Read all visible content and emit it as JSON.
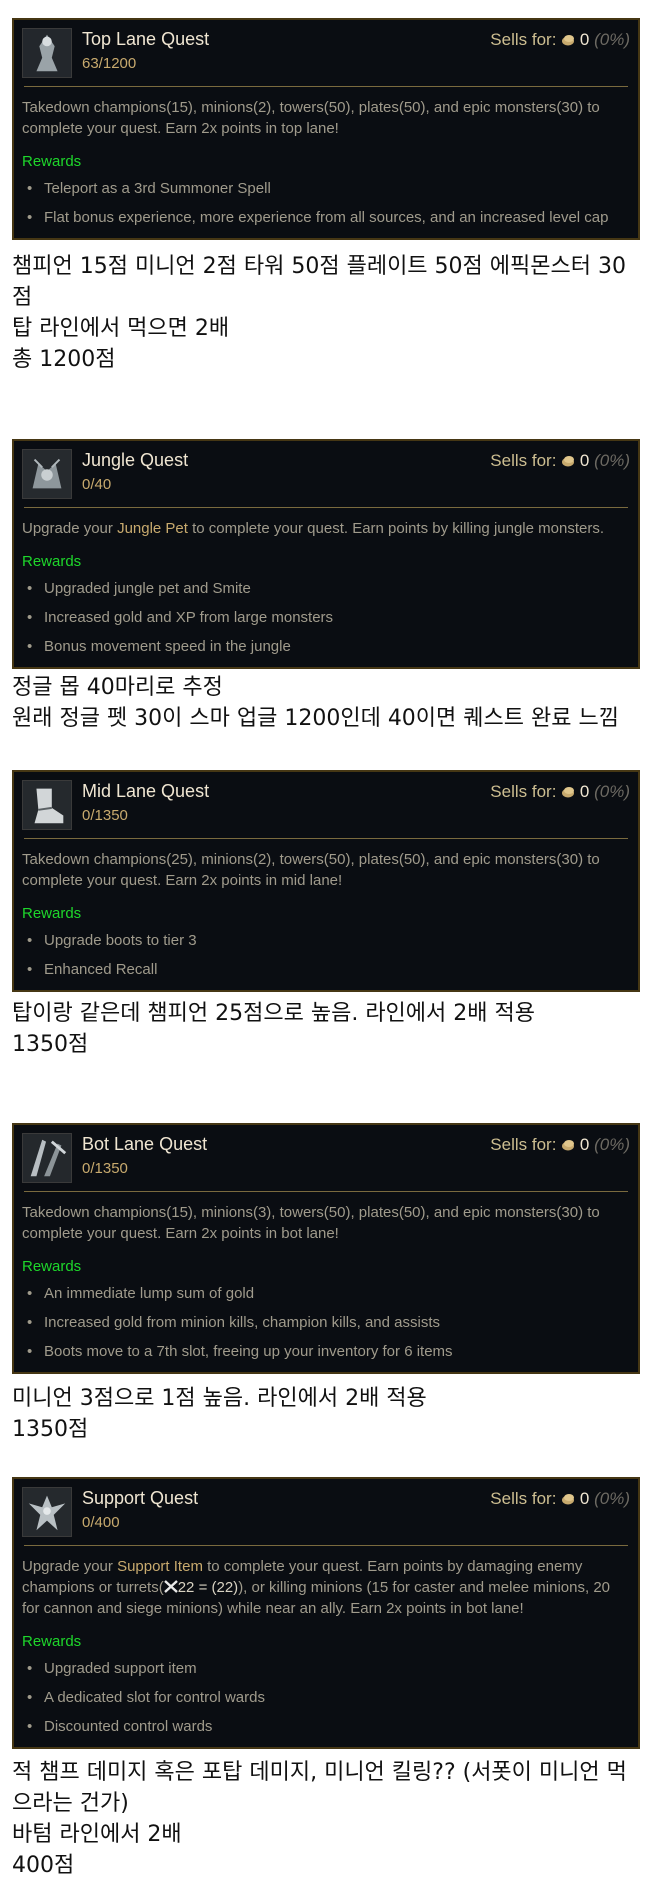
{
  "sells_label": "Sells for:",
  "sells_value": "0",
  "sells_pct": "(0%)",
  "rewards_label": "Rewards",
  "quests": [
    {
      "title": "Top Lane Quest",
      "progress": "63/1200",
      "desc": "Takedown champions(15), minions(2), towers(50), plates(50), and epic monsters(30) to complete your quest. Earn 2x points in top lane!",
      "rewards": [
        "Teleport as a 3rd Summoner Spell",
        "Flat bonus experience, more experience from all sources, and an increased level cap"
      ],
      "icon": "top-lane-quest-icon"
    },
    {
      "title": "Jungle Quest",
      "progress": "0/40",
      "desc_pre": "Upgrade your ",
      "desc_hl": "Jungle Pet",
      "desc_post": " to complete your quest. Earn points by killing jungle monsters.",
      "rewards": [
        "Upgraded jungle pet and Smite",
        "Increased gold and XP from large monsters",
        "Bonus movement speed in the jungle"
      ],
      "icon": "jungle-quest-icon"
    },
    {
      "title": "Mid Lane Quest",
      "progress": "0/1350",
      "desc": "Takedown champions(25), minions(2), towers(50), plates(50), and epic monsters(30) to complete your quest. Earn 2x points in mid lane!",
      "rewards": [
        "Upgrade boots to tier 3",
        "Enhanced Recall"
      ],
      "icon": "mid-lane-quest-icon"
    },
    {
      "title": "Bot Lane Quest",
      "progress": "0/1350",
      "desc": "Takedown champions(15), minions(3), towers(50), plates(50), and epic monsters(30) to complete your quest. Earn 2x points in bot lane!",
      "rewards": [
        "An immediate lump sum of gold",
        "Increased gold from minion kills, champion kills, and assists",
        "Boots move to a 7th slot, freeing up your inventory for 6 items"
      ],
      "icon": "bot-lane-quest-icon"
    },
    {
      "title": "Support Quest",
      "progress": "0/400",
      "desc_pre": "Upgrade your ",
      "desc_hl": "Support Item",
      "desc_post": " to complete your quest. Earn points by damaging enemy champions or turrets(",
      "desc_formula": "22 = (22)",
      "desc_post2": "), or killing minions (15 for caster and melee minions, 20 for cannon and siege minions) while near an ally. Earn 2x points in bot lane!",
      "rewards": [
        "Upgraded support item",
        "A dedicated slot for control wards",
        "Discounted control wards"
      ],
      "icon": "support-quest-icon"
    }
  ],
  "notes": [
    [
      "챔피언 15점 미니언 2점 타워 50점 플레이트 50점 에픽몬스터 30점",
      "탑 라인에서 먹으면 2배",
      "총 1200점"
    ],
    [
      "정글 몹 40마리로 추정",
      "원래 정글 펫 30이 스마 업글 1200인데 40이면 퀘스트 완료 느낌"
    ],
    [
      "탑이랑 같은데 챔피언 25점으로 높음. 라인에서 2배 적용",
      "1350점"
    ],
    [
      "미니언 3점으로 1점 높음. 라인에서 2배 적용",
      "1350점"
    ],
    [
      "적 챔프 데미지 혹은 포탑 데미지, 미니언 킬링?? (서폿이 미니언 먹으라는 건가)",
      "바텀 라인에서 2배",
      "400점"
    ]
  ]
}
